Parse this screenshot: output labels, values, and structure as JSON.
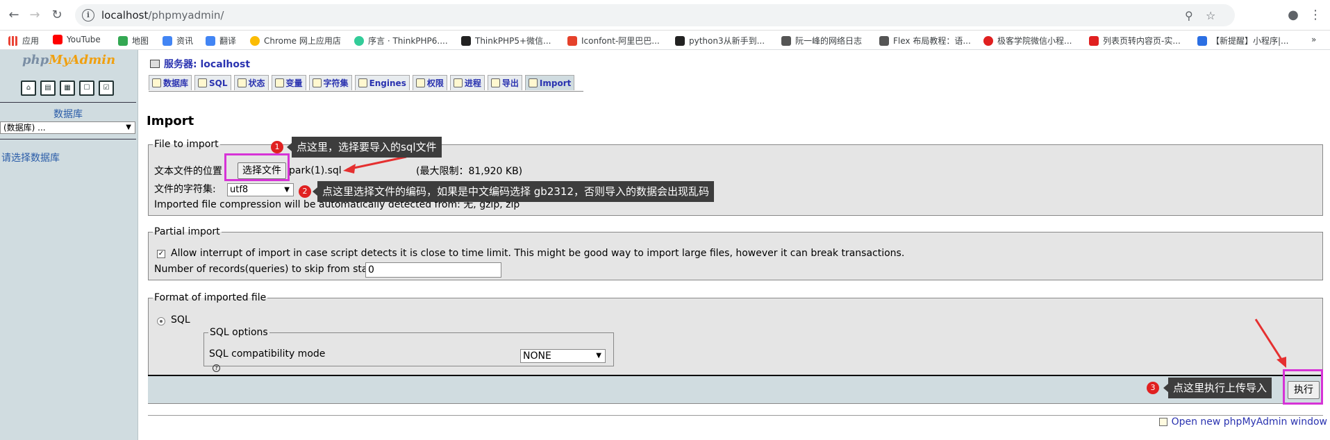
{
  "browser": {
    "url_host": "localhost",
    "url_path": "/phpmyadmin/",
    "bookmarks": [
      "应用",
      "YouTube",
      "地图",
      "资讯",
      "翻译",
      "Chrome 网上应用店",
      "序言 · ThinkPHP6....",
      "ThinkPHP5+微信...",
      "Iconfont-阿里巴巴...",
      "python3从新手到...",
      "阮一峰的网络日志",
      "Flex 布局教程：语...",
      "极客学院微信小程...",
      "列表页转内容页-实...",
      "【新提醒】小程序|...",
      "»"
    ]
  },
  "sidebar": {
    "logo_php": "php",
    "logo_my": "MyAdmin",
    "db_label": "数据库",
    "db_select": "(数据库) ...",
    "choose_db": "请选择数据库"
  },
  "header": {
    "server": "服务器: localhost",
    "tabs": [
      "数据库",
      "SQL",
      "状态",
      "变量",
      "字符集",
      "Engines",
      "权限",
      "进程",
      "导出",
      "Import"
    ]
  },
  "page": {
    "title": "Import",
    "file_section": {
      "legend": "File to import",
      "location_label": "文本文件的位置",
      "choose_button": "选择文件",
      "file_name": "park(1).sql",
      "max_limit": "(最大限制：81,920 KB)",
      "charset_label": "文件的字符集:",
      "charset_value": "utf8",
      "compression_note": "Imported file compression will be automatically detected from: 无, gzip, zip"
    },
    "partial_section": {
      "legend": "Partial import",
      "allow_interrupt": "Allow interrupt of import in case script detects it is close to time limit. This might be good way to import large files, however it can break transactions.",
      "skip_label": "Number of records(queries) to skip from start",
      "skip_value": "0"
    },
    "format_section": {
      "legend": "Format of imported file",
      "format_sql": "SQL",
      "options_legend": "SQL options",
      "compat_label": "SQL compatibility mode",
      "compat_value": "NONE",
      "help": "?"
    },
    "go_button": "执行",
    "new_window": "Open new phpMyAdmin window"
  },
  "annotations": {
    "badge1": "1",
    "tip1": "点这里，选择要导入的sql文件",
    "badge2": "2",
    "tip2": "点这里选择文件的编码，如果是中文编码选择 gb2312，否则导入的数据会出现乱码",
    "badge3": "3",
    "tip3": "点这里执行上传导入",
    "highlight_color": "#d633d6",
    "arrow_color": "#e53030"
  }
}
